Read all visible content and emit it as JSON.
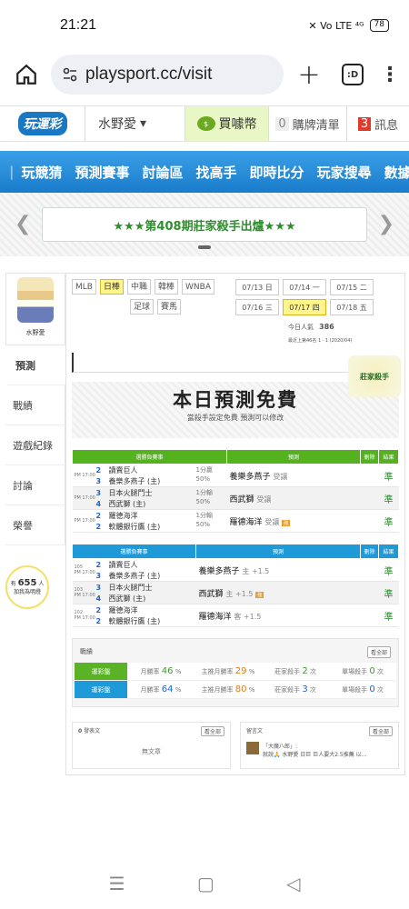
{
  "status": {
    "time": "21:21",
    "battery": "78",
    "icons": "✕ Vo LTE ⁴ᴳ"
  },
  "browser": {
    "url": "playsport.cc/visit",
    "tabs_label": ":D"
  },
  "site": {
    "logo": "玩運彩",
    "user": "水野愛",
    "coin_label": "買噱幣",
    "cart_count": "0",
    "cart_label": "購牌清單",
    "msg_count": "3",
    "msg_label": "訊息"
  },
  "nav": [
    "玩競猜",
    "預測賽事",
    "討論區",
    "找高手",
    "即時比分",
    "玩家搜尋",
    "數據"
  ],
  "banner": {
    "text": "★★★第408期莊家殺手出爐★★★"
  },
  "sidebar": {
    "name": "水野愛",
    "items": [
      "預測",
      "戰績",
      "遊戲紀錄",
      "討論",
      "榮譽"
    ],
    "bulb_prefix": "有",
    "bulb_count": "655",
    "bulb_suffix": "人",
    "bulb_text": "加我為明燈"
  },
  "sports": [
    "MLB",
    "日棒",
    "中職",
    "韓棒",
    "WNBA",
    "足球",
    "賽馬"
  ],
  "dates": [
    "07/13 日",
    "07/14 一",
    "07/15 二",
    "07/16 三",
    "07/17 四",
    "07/18 五"
  ],
  "popularity": {
    "label": "今日人氣",
    "value": "386"
  },
  "rank_text": "最近上第46名 1 · 1 (2020/04)",
  "badge": "莊家殺手",
  "free": {
    "title": "本日預測免費",
    "sub": "當殺手設定免費 預測可以修改"
  },
  "table1": {
    "headers": [
      "選勝負賽事",
      "預測",
      "刪除",
      "結果"
    ],
    "rows": [
      {
        "time": "PM 17:00",
        "n1": "2",
        "t1": "讀賣巨人",
        "n2": "3",
        "t2": "養樂多燕子 (主)",
        "odds1": "1分贏",
        "odds2": "50%",
        "pick": "養樂多燕子",
        "pick_s": "受讓",
        "tag": "",
        "res": "準"
      },
      {
        "time": "PM 17:00",
        "n1": "3",
        "t1": "日本火腿鬥士",
        "n2": "4",
        "t2": "西武獅 (主)",
        "odds1": "1分輸",
        "odds2": "50%",
        "pick": "西武獅",
        "pick_s": "受讓",
        "tag": "",
        "res": "準"
      },
      {
        "time": "PM 17:00",
        "n1": "2",
        "t1": "羅德海洋",
        "n2": "2",
        "t2": "軟體銀行鷹 (主)",
        "odds1": "1分輸",
        "odds2": "50%",
        "pick": "羅德海洋",
        "pick_s": "受讓",
        "tag": "強",
        "res": "準"
      }
    ]
  },
  "table2": {
    "headers": [
      "選勝負賽事",
      "預測",
      "刪除",
      "結果"
    ],
    "rows": [
      {
        "time": "PM 17:00",
        "id": "105",
        "n1": "2",
        "t1": "讀賣巨人",
        "n2": "3",
        "t2": "養樂多燕子 (主)",
        "pick": "養樂多燕子",
        "pick_s": "主 +1.5",
        "tag": "",
        "res": "準"
      },
      {
        "time": "PM 17:00",
        "id": "103",
        "n1": "3",
        "t1": "日本火腿鬥士",
        "n2": "4",
        "t2": "西武獅 (主)",
        "pick": "西武獅",
        "pick_s": "主 +1.5",
        "tag": "強",
        "res": "準"
      },
      {
        "time": "PM 17:00",
        "id": "102",
        "n1": "2",
        "t1": "羅德海洋",
        "n2": "2",
        "t2": "軟體銀行鷹 (主)",
        "pick": "羅德海洋",
        "pick_s": "客 +1.5",
        "tag": "",
        "res": "準"
      }
    ]
  },
  "stats": {
    "title": "戰績",
    "btn": "看全部",
    "rows": [
      {
        "label": "運彩盤",
        "c1": "月勝率 ",
        "v1": "46",
        "u1": " %",
        "c2": "主推月勝率 ",
        "v2": "29",
        "u2": " %",
        "c3": "莊家殺手 ",
        "v3": "2",
        "u3": " 次",
        "c4": "單場殺手 ",
        "v4": "0",
        "u4": " 次"
      },
      {
        "label": "運彩盤",
        "c1": "月勝率 ",
        "v1": "64",
        "u1": " %",
        "c2": "主推月勝率 ",
        "v2": "80",
        "u2": " %",
        "c3": "莊家殺手 ",
        "v3": "3",
        "u3": " 次",
        "c4": "單場殺手 ",
        "v4": "0",
        "u4": " 次"
      }
    ]
  },
  "panels": {
    "left_count": "0",
    "left_title": "發表文",
    "left_btn": "看全部",
    "left_empty": "無文章",
    "right_title": "留言文",
    "right_btn": "看全部",
    "right_quote": "「大魔八郎」:",
    "right_text": "就說🙏 水野愛 日巨 巨人要大2.5推薦 以..."
  }
}
